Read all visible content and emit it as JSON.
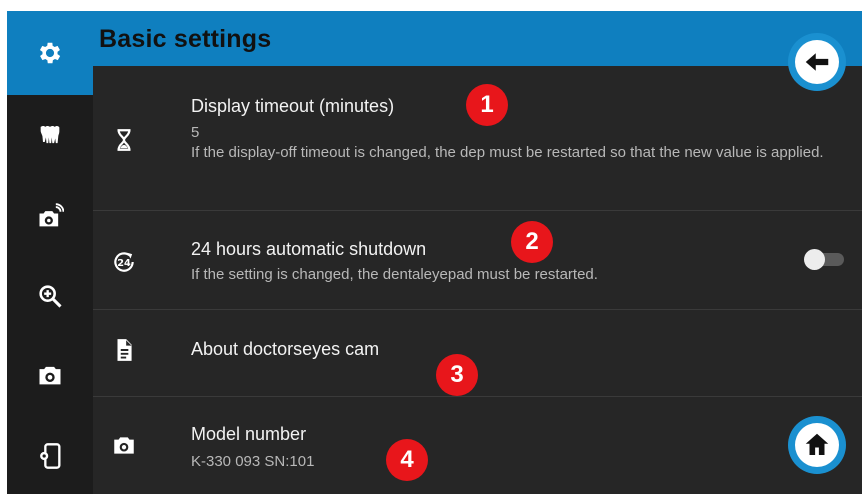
{
  "header": {
    "title": "Basic settings"
  },
  "sidebar": {
    "items": [
      {
        "icon": "gear-icon",
        "active": true
      },
      {
        "icon": "teeth-icon"
      },
      {
        "icon": "wireless-camera-icon"
      },
      {
        "icon": "zoom-in-icon"
      },
      {
        "icon": "camera-icon"
      },
      {
        "icon": "device-settings-icon"
      }
    ]
  },
  "settings": [
    {
      "icon": "hourglass-icon",
      "title": "Display timeout (minutes)",
      "value": "5",
      "description": "If the display-off timeout is changed, the dep must be restarted so that the new value is applied.",
      "badge": "1"
    },
    {
      "icon": "24-hour-icon",
      "title": "24 hours automatic shutdown",
      "description": "If the setting is changed, the dentaleyepad must be restarted.",
      "toggle_on": false,
      "badge": "2"
    },
    {
      "icon": "document-icon",
      "title": "About doctorseyes cam",
      "badge": "3"
    },
    {
      "icon": "camera-icon",
      "title": "Model number",
      "value": "K-330 093 SN:101",
      "badge": "4"
    }
  ],
  "colors": {
    "accent": "#0f7fbf",
    "badge": "#e8161b",
    "background": "#262626"
  }
}
